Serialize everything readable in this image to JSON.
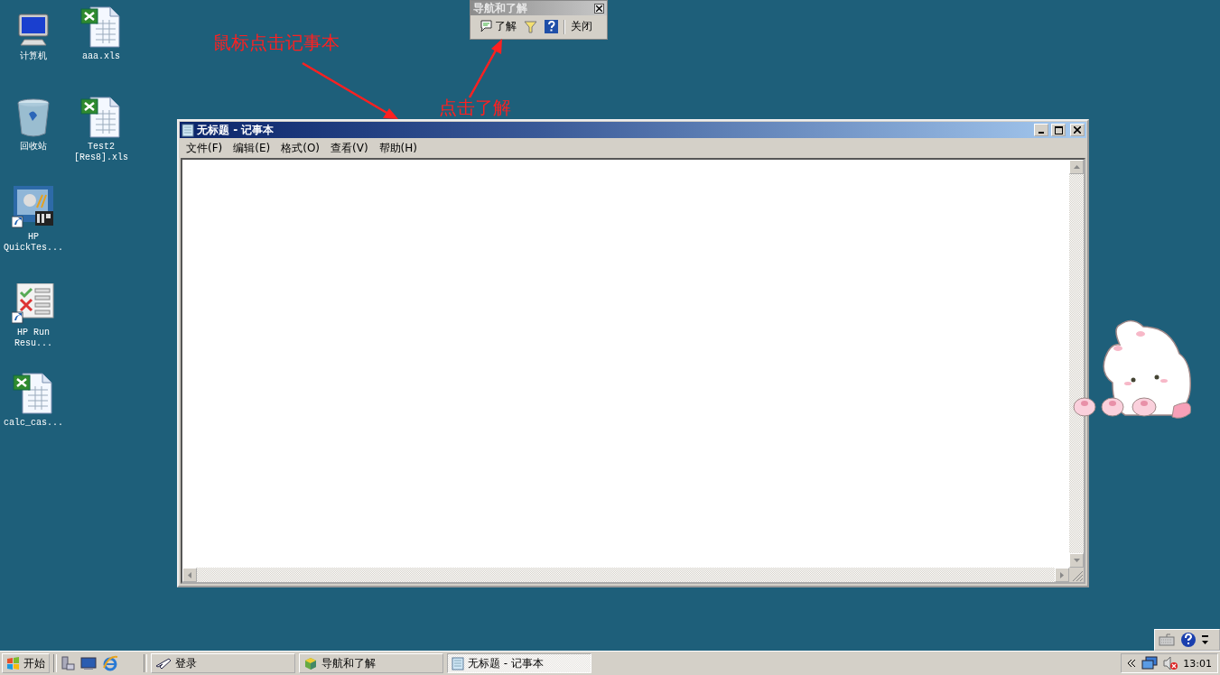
{
  "desktop_icons": [
    {
      "label": "计算机",
      "kind": "computer"
    },
    {
      "label": "aaa.xls",
      "kind": "excel"
    },
    {
      "label": "回收站",
      "kind": "recycle"
    },
    {
      "label": "Test2 [Res8].xls",
      "kind": "excel"
    },
    {
      "label": "HP QuickTes...",
      "kind": "qtp"
    },
    {
      "label": "HP Run Resu...",
      "kind": "results"
    },
    {
      "label": "calc_cas...",
      "kind": "excel"
    }
  ],
  "annotations": [
    {
      "text": "鼠标点击记事本"
    },
    {
      "text": "点击了解"
    }
  ],
  "nav_toolbar": {
    "title": "导航和了解",
    "buttons": [
      {
        "label": "了解",
        "kind": "learn"
      },
      {
        "kind": "filter"
      },
      {
        "kind": "help"
      },
      {
        "label": "关闭",
        "kind": "close"
      }
    ]
  },
  "notepad": {
    "title": "无标题 - 记事本",
    "menu": [
      "文件(F)",
      "编辑(E)",
      "格式(O)",
      "查看(V)",
      "帮助(H)"
    ]
  },
  "taskbar": {
    "start": "开始",
    "tasks": [
      {
        "label": "登录",
        "kind": "plane",
        "selected": false
      },
      {
        "label": "导航和了解",
        "kind": "cube",
        "selected": false
      },
      {
        "label": "无标题 - 记事本",
        "kind": "notepad",
        "selected": true
      }
    ],
    "clock": "13:01"
  }
}
